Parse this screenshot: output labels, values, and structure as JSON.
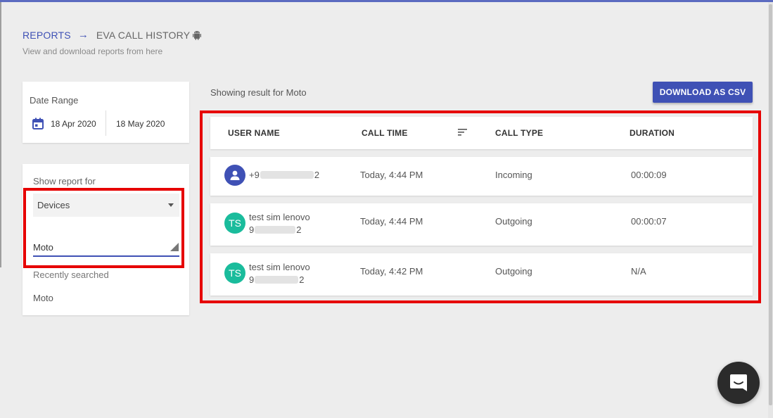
{
  "breadcrumb": {
    "reports": "REPORTS",
    "arrow": "→",
    "current": "EVA CALL HISTORY"
  },
  "subtitle": "View and download reports from here",
  "date_range": {
    "label": "Date Range",
    "from": "18 Apr 2020",
    "to": "18 May 2020"
  },
  "report_filter": {
    "label": "Show report for",
    "select_value": "Devices",
    "search_value": "Moto",
    "recent_label": "Recently searched",
    "recent_items": [
      "Moto"
    ]
  },
  "results": {
    "showing_text": "Showing result for Moto",
    "download_label": "DOWNLOAD AS CSV"
  },
  "table": {
    "headers": [
      "USER NAME",
      "CALL TIME",
      "CALL TYPE",
      "DURATION"
    ],
    "rows": [
      {
        "avatar": "person-icon",
        "name": "",
        "phone_prefix": "+9",
        "phone_suffix": "2",
        "call_time": "Today, 4:44 PM",
        "call_type": "Incoming",
        "duration": "00:00:09"
      },
      {
        "avatar": "TS",
        "name": "test sim lenovo",
        "phone_prefix": "9",
        "phone_suffix": "2",
        "call_time": "Today, 4:44 PM",
        "call_type": "Outgoing",
        "duration": "00:00:07"
      },
      {
        "avatar": "TS",
        "name": "test sim lenovo",
        "phone_prefix": "9",
        "phone_suffix": "2",
        "call_time": "Today, 4:42 PM",
        "call_type": "Outgoing",
        "duration": "N/A"
      }
    ]
  },
  "colors": {
    "accent": "#3f51b5",
    "avatar_initials": "#1abc9c",
    "highlight": "#e60000",
    "chat_button": "#2b2b2b"
  }
}
